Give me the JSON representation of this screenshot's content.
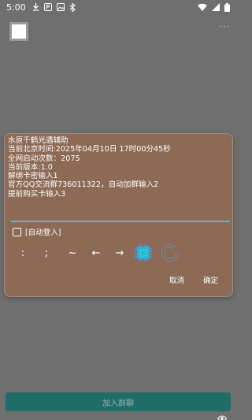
{
  "status_bar": {
    "time": "5:00"
  },
  "app_bar": {
    "overflow": "⋯"
  },
  "dialog": {
    "lines": [
      "水原千鹤光遇辅助",
      "当前北京时间:2025年04月10日 17时00分45秒",
      "全网启动次数：2075",
      "当前版本:1.0",
      "解绑卡密输入1",
      "官方QQ交流群736011322，自动加群输入2",
      "提前购买卡输入3"
    ],
    "input_value": "",
    "checkbox_label": "[自动登入]",
    "symbols": [
      ":",
      ";",
      "~",
      "←",
      "→"
    ],
    "cancel_label": "取消",
    "confirm_label": "确定"
  },
  "bottom": {
    "join_button_label": "加入群聊"
  },
  "colors": {
    "background": "#6f6f6f",
    "dialog": "#8c6a55",
    "accent": "#4fc1b8",
    "button": "#1f6d69"
  },
  "icons": [
    "download-icon",
    "parking-icon",
    "image-icon",
    "bluetooth-icon",
    "wifi-icon",
    "cell-signal-icon",
    "battery-icon",
    "cpu-chip-icon",
    "refresh-icon",
    "eye-icon"
  ]
}
